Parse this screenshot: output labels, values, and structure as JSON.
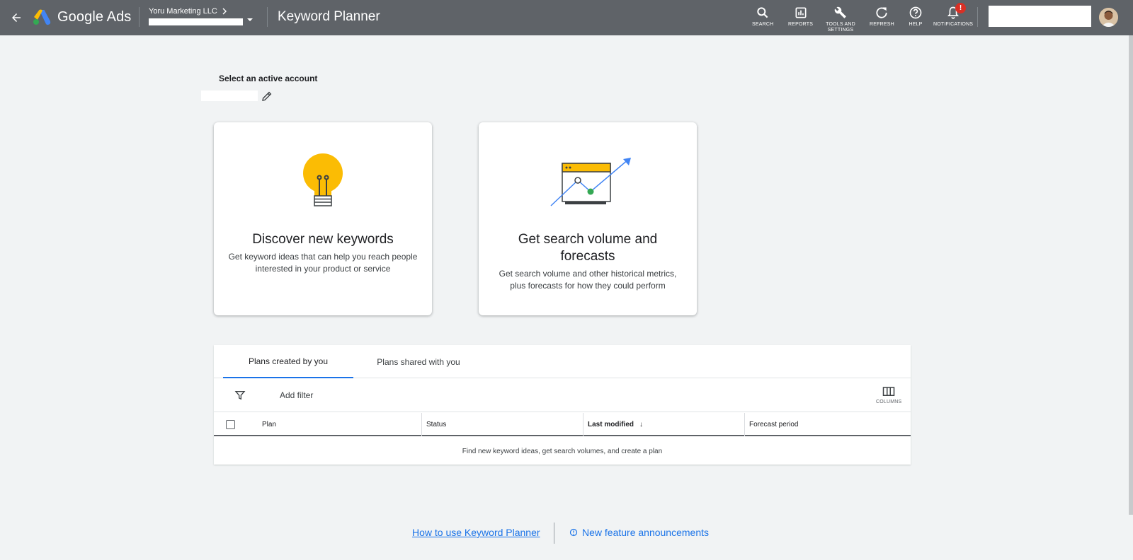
{
  "header": {
    "brand": "Google Ads",
    "account_name": "Yoru Marketing LLC",
    "page_title": "Keyword Planner",
    "tools": [
      {
        "label": "SEARCH"
      },
      {
        "label": "REPORTS"
      },
      {
        "label": "TOOLS AND SETTINGS"
      },
      {
        "label": "REFRESH"
      },
      {
        "label": "HELP"
      },
      {
        "label": "NOTIFICATIONS"
      }
    ],
    "notification_badge": "!",
    "search_value": ""
  },
  "account_select": {
    "label": "Select an active account"
  },
  "cards": [
    {
      "title": "Discover new keywords",
      "desc": "Get keyword ideas that can help you reach people interested in your product or service"
    },
    {
      "title": "Get search volume and forecasts",
      "desc": "Get search volume and other historical metrics, plus forecasts for how they could perform"
    }
  ],
  "plans": {
    "tabs": [
      {
        "label": "Plans created by you",
        "active": true
      },
      {
        "label": "Plans shared with you",
        "active": false
      }
    ],
    "add_filter": "Add filter",
    "columns_label": "COLUMNS",
    "headers": [
      "Plan",
      "Status",
      "Last modified",
      "Forecast period"
    ],
    "sort_indicator": "↓",
    "empty_message": "Find new keyword ideas, get search volumes, and create a plan"
  },
  "footer": {
    "how_to": "How to use Keyword Planner",
    "announcements": "New feature announcements"
  },
  "colors": {
    "topbar": "#5f6368",
    "accent": "#1a73e8",
    "bulb": "#fbbc04",
    "badge": "#d93025"
  }
}
